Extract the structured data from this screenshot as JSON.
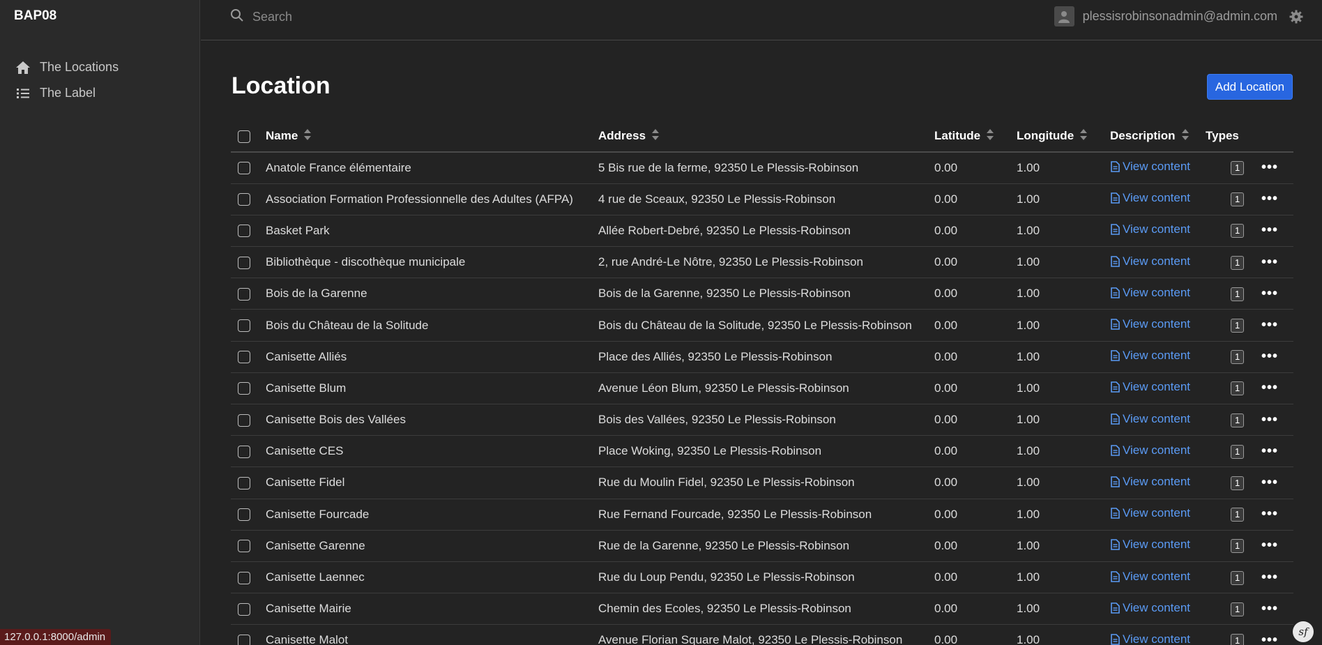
{
  "app": {
    "brand": "BAP08"
  },
  "sidebar": {
    "items": [
      {
        "label": "The Locations",
        "icon": "home-icon"
      },
      {
        "label": "The Label",
        "icon": "list-icon"
      }
    ]
  },
  "header": {
    "search_placeholder": "Search",
    "user_email": "plessisrobinsonadmin@admin.com"
  },
  "page": {
    "title": "Location",
    "add_button": "Add Location"
  },
  "table": {
    "columns": [
      "Name",
      "Address",
      "Latitude",
      "Longitude",
      "Description",
      "Types"
    ],
    "view_label": "View content",
    "rows": [
      {
        "name": "Anatole France élémentaire",
        "address": "5 Bis rue de la ferme, 92350 Le Plessis-Robinson",
        "lat": "0.00",
        "lng": "1.00",
        "types": "1"
      },
      {
        "name": "Association Formation Professionnelle des Adultes (AFPA)",
        "address": "4 rue de Sceaux, 92350 Le Plessis-Robinson",
        "lat": "0.00",
        "lng": "1.00",
        "types": "1"
      },
      {
        "name": "Basket Park",
        "address": "Allée Robert-Debré, 92350 Le Plessis-Robinson",
        "lat": "0.00",
        "lng": "1.00",
        "types": "1"
      },
      {
        "name": "Bibliothèque - discothèque municipale",
        "address": "2, rue André-Le Nôtre, 92350 Le Plessis-Robinson",
        "lat": "0.00",
        "lng": "1.00",
        "types": "1"
      },
      {
        "name": "Bois de la Garenne",
        "address": "Bois de la Garenne, 92350 Le Plessis-Robinson",
        "lat": "0.00",
        "lng": "1.00",
        "types": "1"
      },
      {
        "name": "Bois du Château de la Solitude",
        "address": "Bois du Château de la Solitude, 92350 Le Plessis-Robinson",
        "lat": "0.00",
        "lng": "1.00",
        "types": "1"
      },
      {
        "name": "Canisette Alliés",
        "address": "Place des Alliés, 92350 Le Plessis-Robinson",
        "lat": "0.00",
        "lng": "1.00",
        "types": "1"
      },
      {
        "name": "Canisette Blum",
        "address": "Avenue Léon Blum, 92350 Le Plessis-Robinson",
        "lat": "0.00",
        "lng": "1.00",
        "types": "1"
      },
      {
        "name": "Canisette Bois des Vallées",
        "address": "Bois des Vallées, 92350 Le Plessis-Robinson",
        "lat": "0.00",
        "lng": "1.00",
        "types": "1"
      },
      {
        "name": "Canisette CES",
        "address": "Place Woking, 92350 Le Plessis-Robinson",
        "lat": "0.00",
        "lng": "1.00",
        "types": "1"
      },
      {
        "name": "Canisette Fidel",
        "address": "Rue du Moulin Fidel, 92350 Le Plessis-Robinson",
        "lat": "0.00",
        "lng": "1.00",
        "types": "1"
      },
      {
        "name": "Canisette Fourcade",
        "address": "Rue Fernand Fourcade, 92350 Le Plessis-Robinson",
        "lat": "0.00",
        "lng": "1.00",
        "types": "1"
      },
      {
        "name": "Canisette Garenne",
        "address": "Rue de la Garenne, 92350 Le Plessis-Robinson",
        "lat": "0.00",
        "lng": "1.00",
        "types": "1"
      },
      {
        "name": "Canisette Laennec",
        "address": "Rue du Loup Pendu, 92350 Le Plessis-Robinson",
        "lat": "0.00",
        "lng": "1.00",
        "types": "1"
      },
      {
        "name": "Canisette Mairie",
        "address": "Chemin des Ecoles, 92350 Le Plessis-Robinson",
        "lat": "0.00",
        "lng": "1.00",
        "types": "1"
      },
      {
        "name": "Canisette Malot",
        "address": "Avenue Florian Square Malot, 92350 Le Plessis-Robinson",
        "lat": "0.00",
        "lng": "1.00",
        "types": "1"
      }
    ]
  },
  "status_url": "127.0.0.1:8000/admin",
  "colors": {
    "accent": "#2866e0",
    "link": "#5b9bf5",
    "background": "#232323",
    "sidebar": "#2a2a2a"
  }
}
